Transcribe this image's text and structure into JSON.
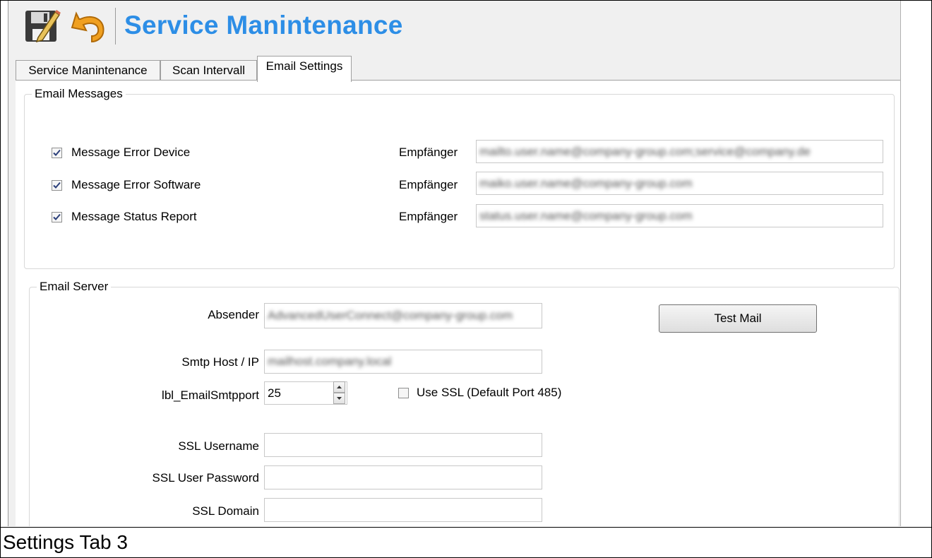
{
  "header": {
    "title": "Service Manintenance",
    "icons": [
      "save-edit-icon",
      "undo-icon"
    ]
  },
  "tabs": [
    {
      "label": "Service Manintenance",
      "active": false
    },
    {
      "label": "Scan Intervall",
      "active": false
    },
    {
      "label": "Email Settings",
      "active": true
    }
  ],
  "email_messages": {
    "title": "Email Messages",
    "rows": [
      {
        "label": "Message Error Device",
        "checked": true,
        "recipient_label": "Empfänger",
        "recipient_value": "mailto.user.name@company-group.com;service@company.de"
      },
      {
        "label": "Message Error Software",
        "checked": true,
        "recipient_label": "Empfänger",
        "recipient_value": "maiko.user.name@company-group.com"
      },
      {
        "label": "Message Status Report",
        "checked": true,
        "recipient_label": "Empfänger",
        "recipient_value": "status.user.name@company-group.com"
      }
    ]
  },
  "email_server": {
    "title": "Email Server",
    "sender_label": "Absender",
    "sender_value": "AdvancedUserConnect@company-group.com",
    "test_mail_button": "Test Mail",
    "smtp_label": "Smtp Host / IP",
    "smtp_value": "mailhost.company.local",
    "port_label": "lbl_EmailSmtpport",
    "port_value": "25",
    "ssl_checkbox_label": "Use SSL (Default Port 485)",
    "ssl_checked": false,
    "ssl_username_label": "SSL Username",
    "ssl_username_value": "",
    "ssl_password_label": "SSL User Password",
    "ssl_password_value": "",
    "ssl_domain_label": "SSL Domain",
    "ssl_domain_value": ""
  },
  "caption": "Settings Tab 3"
}
